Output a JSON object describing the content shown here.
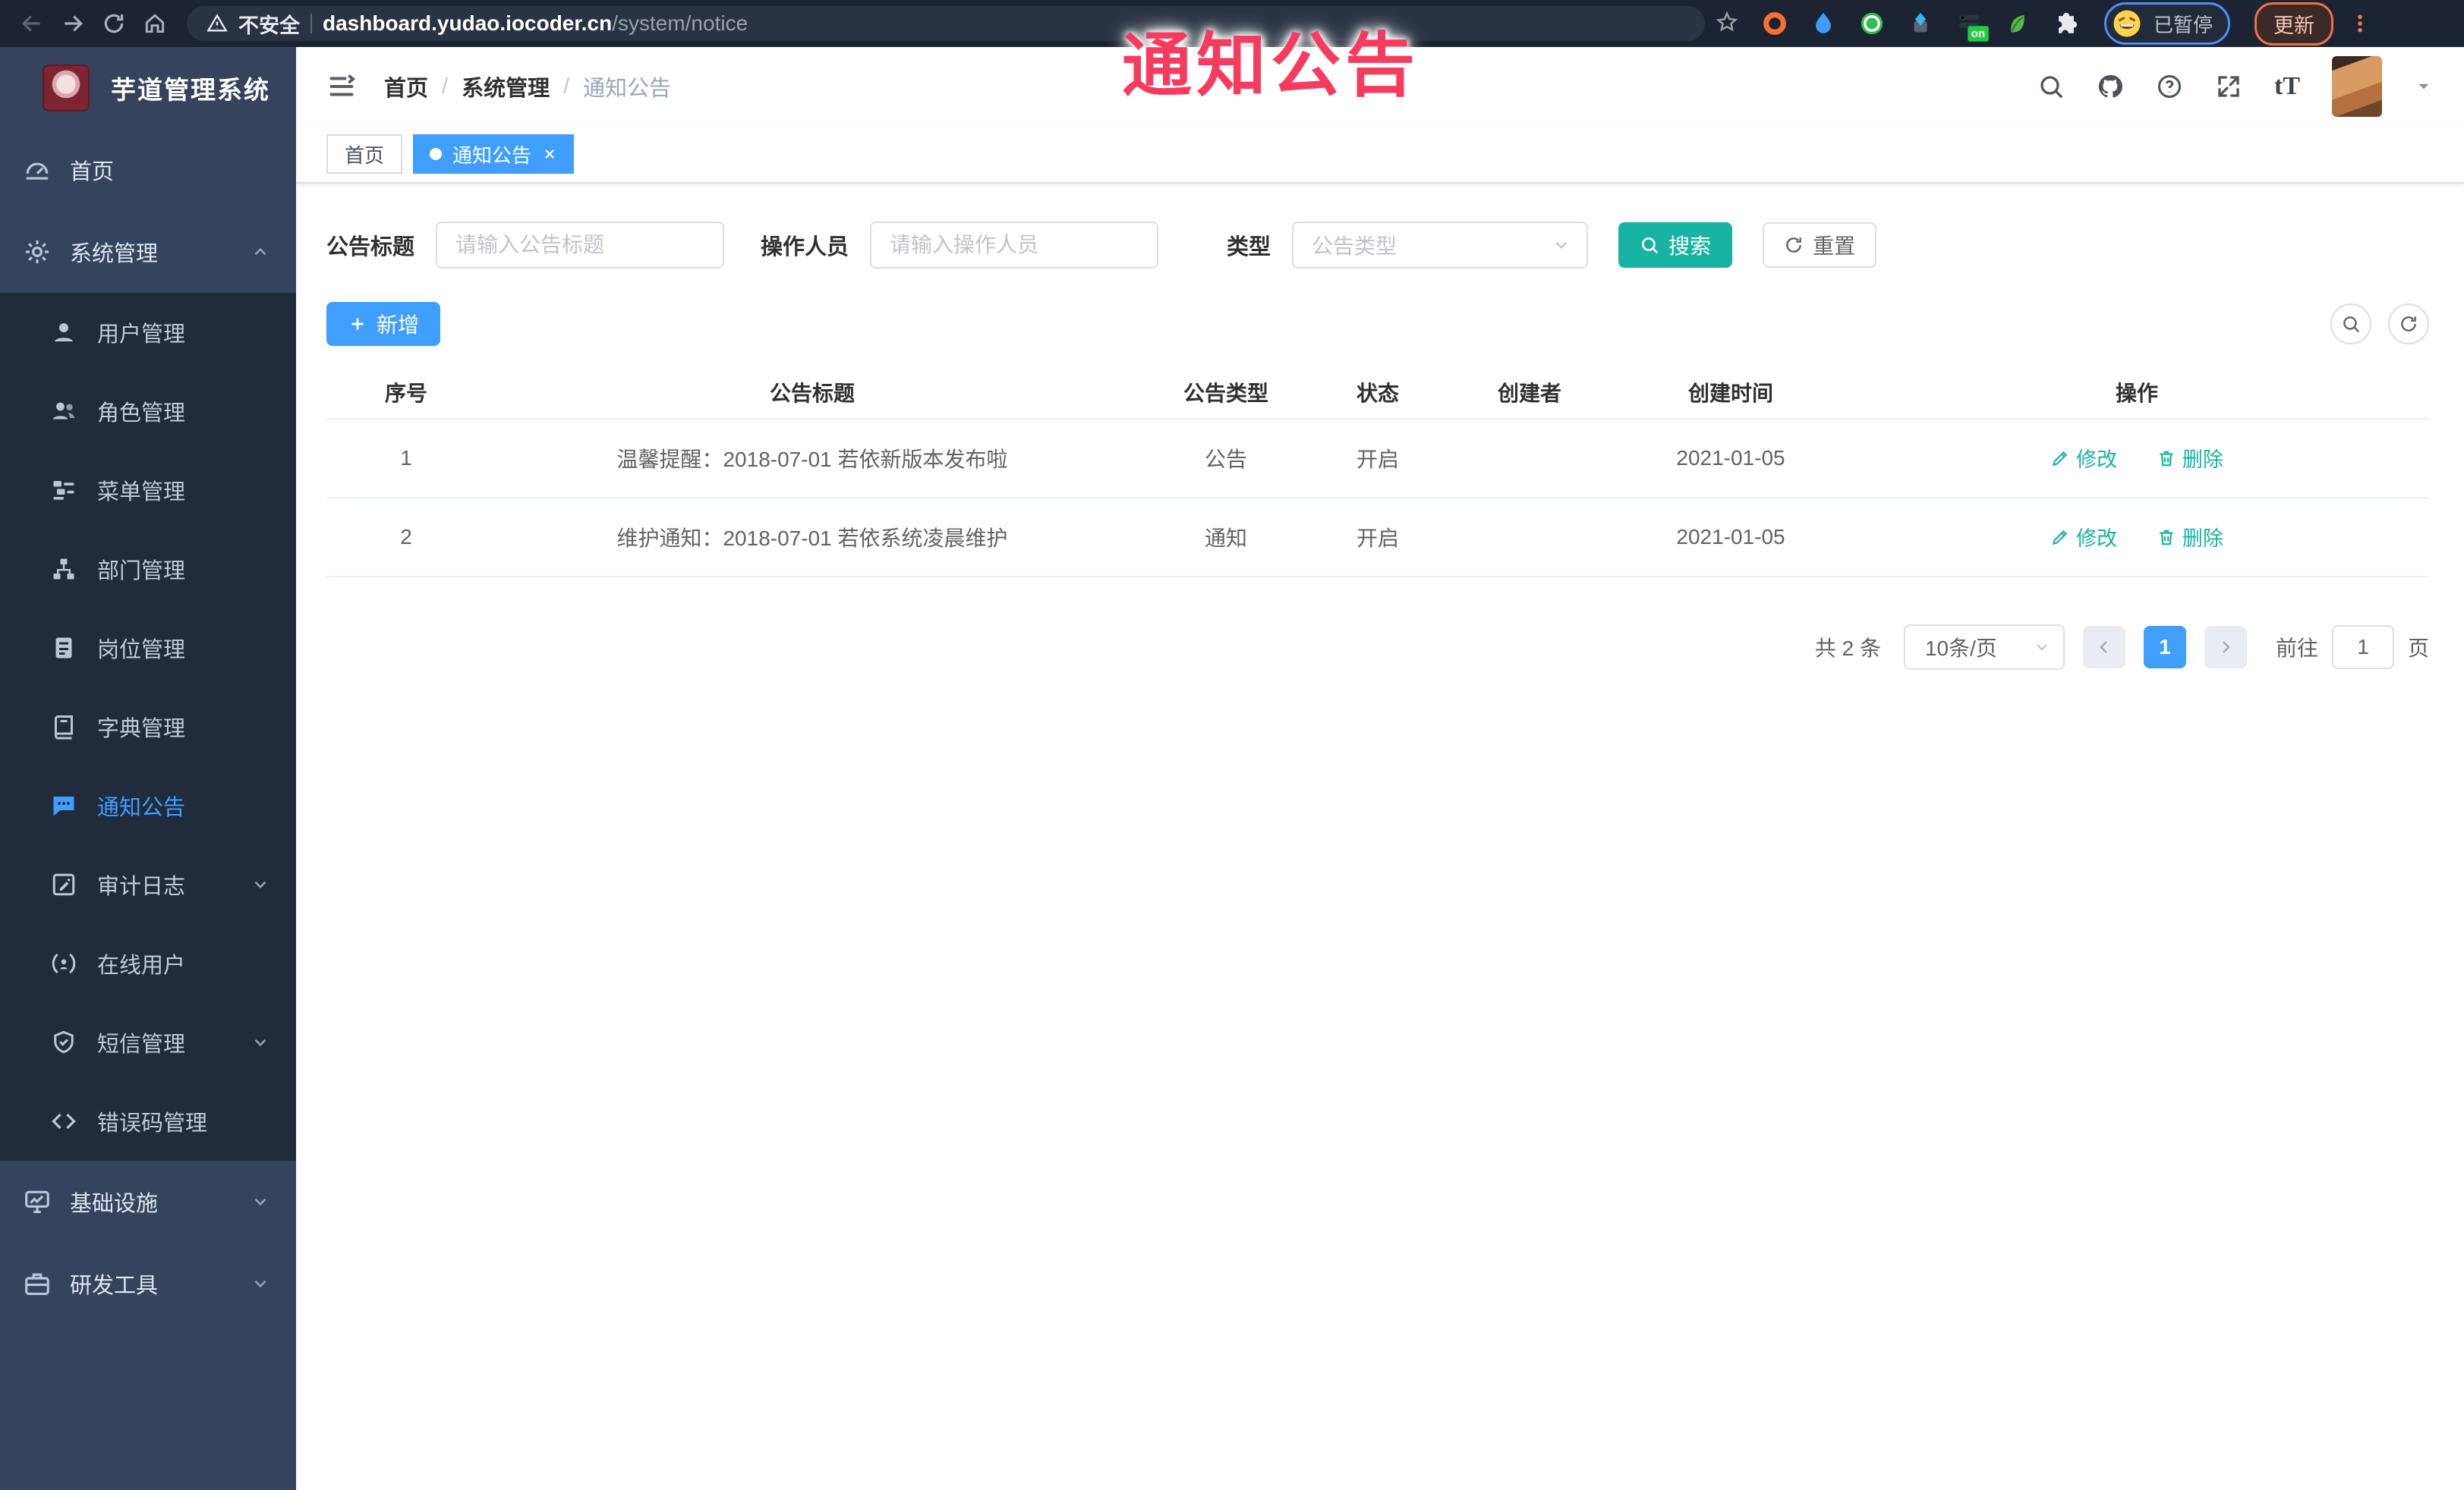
{
  "browser": {
    "not_secure_label": "不安全",
    "url_host": "dashboard.yudao.iocoder.cn",
    "url_path": "/system/notice",
    "extension_badge": "on",
    "paused_label": "已暂停",
    "update_label": "更新"
  },
  "overlay": {
    "text": "通知公告",
    "color": "#f73b5f"
  },
  "sidebar": {
    "title": "芋道管理系统",
    "items": [
      {
        "label": "首页"
      },
      {
        "label": "系统管理"
      },
      {
        "label": "用户管理"
      },
      {
        "label": "角色管理"
      },
      {
        "label": "菜单管理"
      },
      {
        "label": "部门管理"
      },
      {
        "label": "岗位管理"
      },
      {
        "label": "字典管理"
      },
      {
        "label": "通知公告"
      },
      {
        "label": "审计日志"
      },
      {
        "label": "在线用户"
      },
      {
        "label": "短信管理"
      },
      {
        "label": "错误码管理"
      },
      {
        "label": "基础设施"
      },
      {
        "label": "研发工具"
      }
    ]
  },
  "header": {
    "breadcrumb": [
      "首页",
      "系统管理",
      "通知公告"
    ],
    "separator": "/",
    "font_icon_label": "tT"
  },
  "tabs": [
    {
      "label": "首页"
    },
    {
      "label": "通知公告"
    }
  ],
  "filters": {
    "title_label": "公告标题",
    "title_placeholder": "请输入公告标题",
    "operator_label": "操作人员",
    "operator_placeholder": "请输入操作人员",
    "type_label": "类型",
    "type_placeholder": "公告类型",
    "search_label": "搜索",
    "reset_label": "重置"
  },
  "toolbar": {
    "add_label": "新增"
  },
  "table": {
    "columns": [
      "序号",
      "公告标题",
      "公告类型",
      "状态",
      "创建者",
      "创建时间",
      "操作"
    ],
    "rows": [
      {
        "seq": "1",
        "title": "温馨提醒：2018-07-01 若依新版本发布啦",
        "type": "公告",
        "status": "开启",
        "creator": "",
        "created": "2021-01-05",
        "edit": "修改",
        "delete": "删除"
      },
      {
        "seq": "2",
        "title": "维护通知：2018-07-01 若依系统凌晨维护",
        "type": "通知",
        "status": "开启",
        "creator": "",
        "created": "2021-01-05",
        "edit": "修改",
        "delete": "删除"
      }
    ]
  },
  "pagination": {
    "total": "共 2 条",
    "page_size": "10条/页",
    "current": "1",
    "goto_label": "前往",
    "goto_value": "1",
    "unit_label": "页"
  },
  "colors": {
    "accent_blue": "#409eff",
    "action_teal": "#17b3a3",
    "overlay_red": "#f73b5f",
    "sidebar_bg": "#36435c",
    "submenu_bg": "#202b3c",
    "browser_bar_bg": "#1c2433"
  }
}
